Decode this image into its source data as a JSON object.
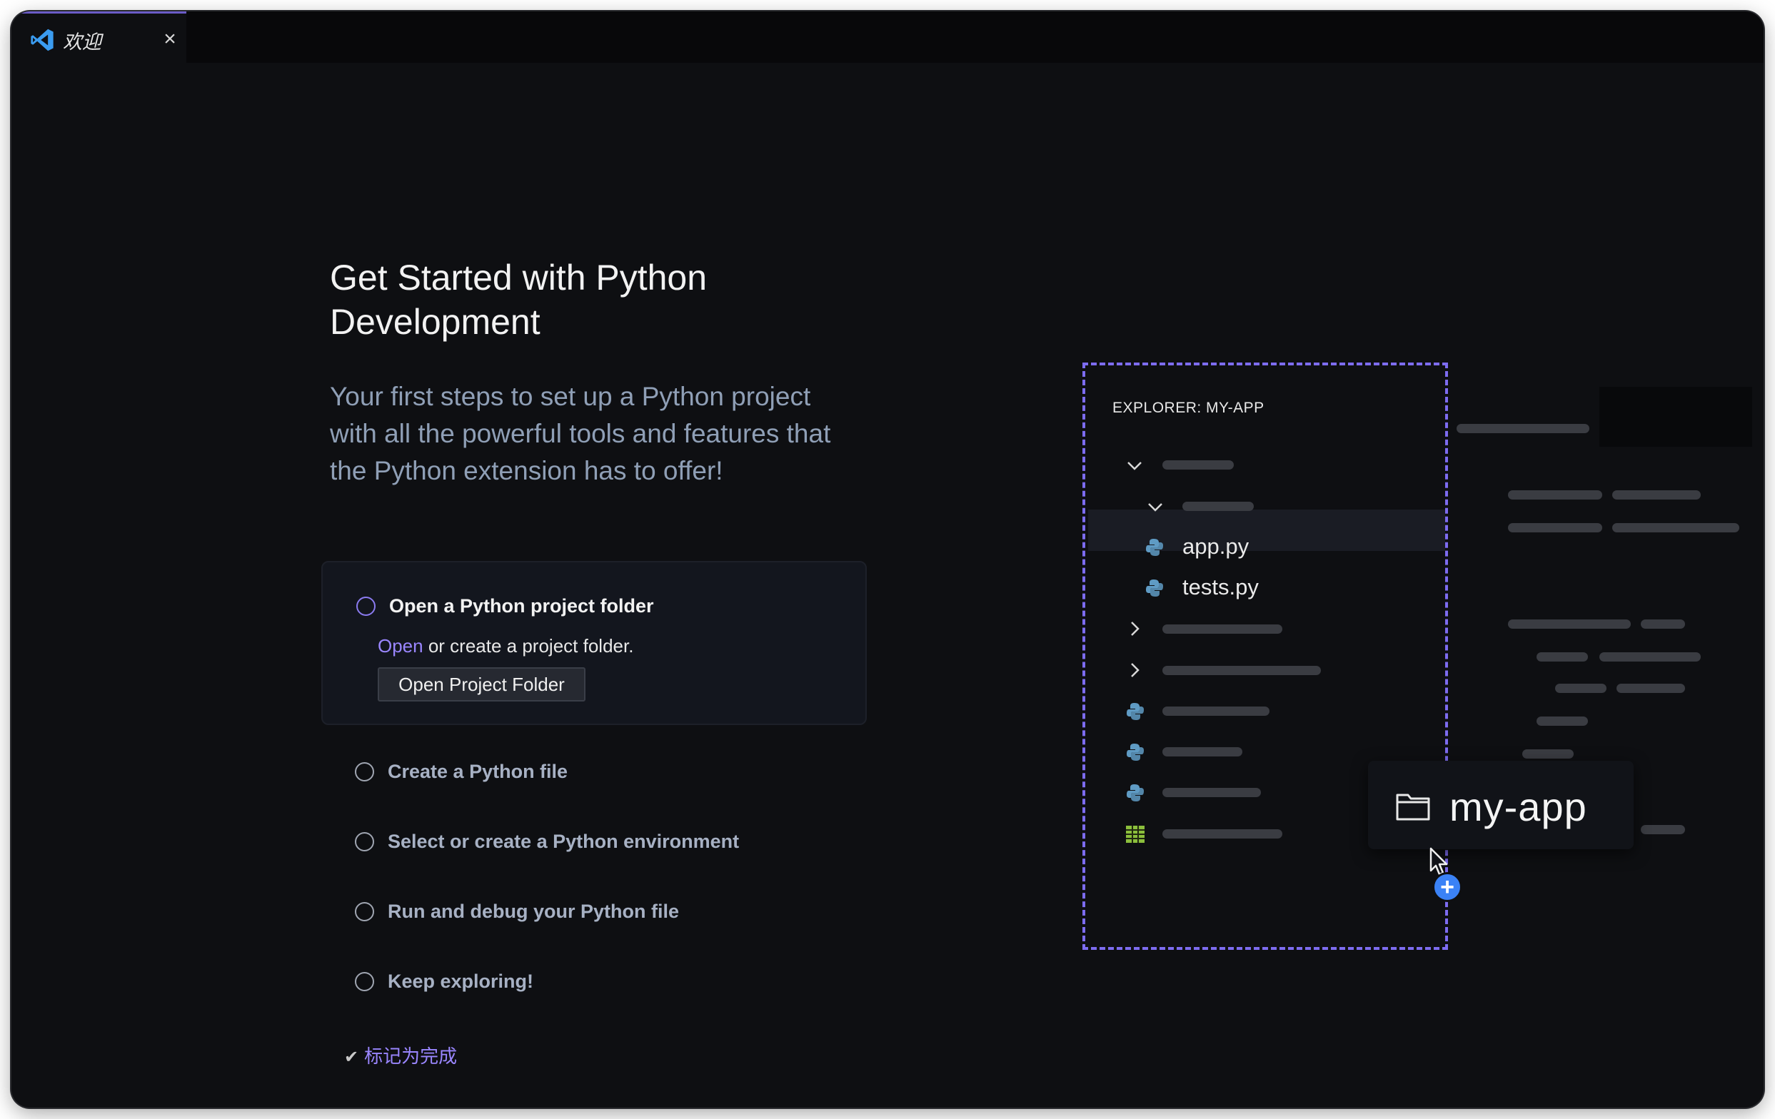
{
  "tab": {
    "title": "欢迎",
    "close_label": "×",
    "logo_icon": "vscode-logo-icon"
  },
  "page": {
    "heading_line1": "Get Started with Python",
    "heading_line2": "Development",
    "subtitle_line1": "Your first steps to set up a Python project",
    "subtitle_line2": "with all the powerful tools and features that",
    "subtitle_line3": "the Python extension has to offer!"
  },
  "steps": [
    {
      "title": "Open a Python project folder",
      "expanded": true
    },
    {
      "title": "Create a Python file"
    },
    {
      "title": "Select or create a Python environment"
    },
    {
      "title": "Run and debug your Python file"
    },
    {
      "title": "Keep exploring!"
    }
  ],
  "step_detail": {
    "link_text": "Open",
    "rest_text": " or create a project folder.",
    "button_label": "Open Project Folder"
  },
  "mark_done": {
    "check": "✔︎",
    "label": "标记为完成"
  },
  "illustration": {
    "explorer_title": "EXPLORER: MY-APP",
    "files": [
      "app.py",
      "tests.py"
    ],
    "folder_name": "my-app",
    "plus": "+"
  },
  "colors": {
    "accent": "#8b7bf0",
    "link": "#9a86ff",
    "background": "#0e0f12",
    "dashed_border": "#7d6cf0",
    "python_icon": "#5f9bc4"
  }
}
